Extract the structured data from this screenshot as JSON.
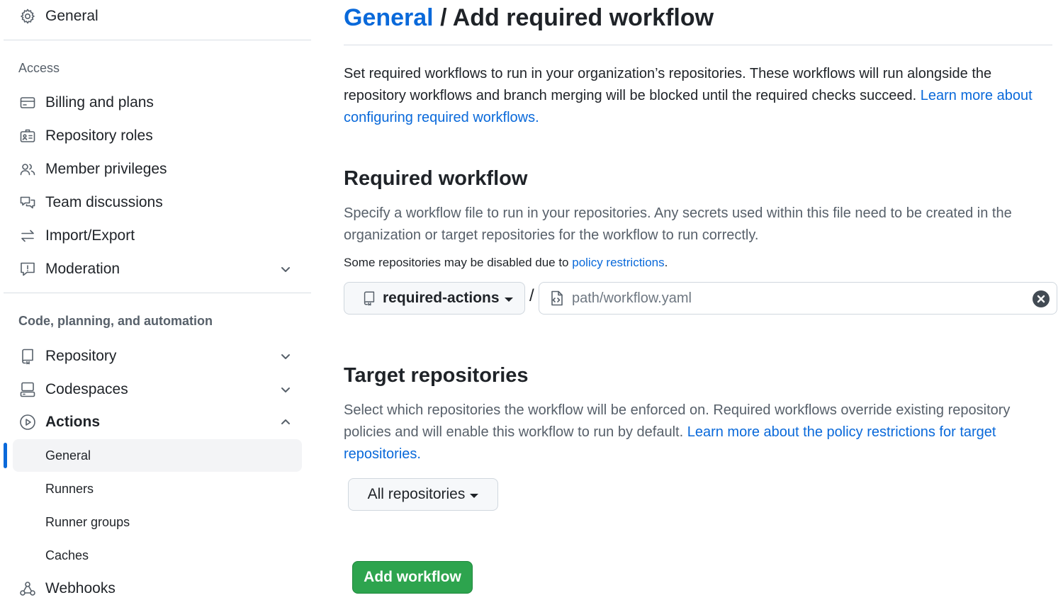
{
  "sidebar": {
    "general_label": "General",
    "access_heading": "Access",
    "access_items": [
      {
        "label": "Billing and plans",
        "icon": "credit-card-icon"
      },
      {
        "label": "Repository roles",
        "icon": "id-badge-icon"
      },
      {
        "label": "Member privileges",
        "icon": "people-icon"
      },
      {
        "label": "Team discussions",
        "icon": "comment-discussion-icon"
      },
      {
        "label": "Import/Export",
        "icon": "arrow-switch-icon"
      },
      {
        "label": "Moderation",
        "icon": "report-icon",
        "expandable": true
      }
    ],
    "code_heading": "Code, planning, and automation",
    "code_items": [
      {
        "label": "Repository",
        "icon": "repo-icon",
        "expandable": true
      },
      {
        "label": "Codespaces",
        "icon": "codespaces-icon",
        "expandable": true
      },
      {
        "label": "Actions",
        "icon": "play-icon",
        "expanded": true
      }
    ],
    "actions_subitems": [
      {
        "label": "General",
        "active": true
      },
      {
        "label": "Runners"
      },
      {
        "label": "Runner groups"
      },
      {
        "label": "Caches"
      }
    ],
    "webhooks_label": "Webhooks"
  },
  "header": {
    "crumb": "General",
    "separator": " / ",
    "title": "Add required workflow"
  },
  "intro": {
    "text": "Set required workflows to run in your organization’s repositories. These workflows will run alongside the repository workflows and branch merging will be blocked until the required checks succeed. ",
    "link": "Learn more about configuring required workflows."
  },
  "required_workflow": {
    "heading": "Required workflow",
    "description": "Specify a workflow file to run in your repositories. Any secrets used within this file need to be created in the organization or target repositories for the workflow to run correctly.",
    "note_text": "Some repositories may be disabled due to ",
    "note_link": "policy restrictions",
    "note_end": ".",
    "repo_selector": "required-actions",
    "path_separator": "/",
    "path_placeholder": "path/workflow.yaml"
  },
  "target": {
    "heading": "Target repositories",
    "description": "Select which repositories the workflow will be enforced on. Required workflows override existing repository policies and will enable this workflow to run by default. ",
    "link": "Learn more about the policy restrictions for target repositories.",
    "selector": "All repositories"
  },
  "actions": {
    "add_label": "Add workflow"
  },
  "colors": {
    "accent": "#0969da",
    "primary_button": "#2da44e"
  }
}
